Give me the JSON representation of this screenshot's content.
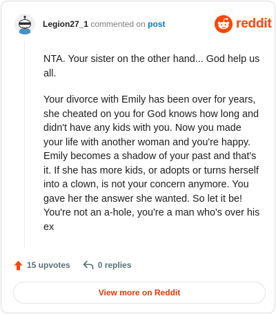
{
  "comment": {
    "username": "Legion27_1",
    "commented_on": "commented on",
    "post_link": "post",
    "paragraphs": [
      "NTA. Your sister on the other hand... God help us all.",
      "Your divorce with Emily has been over for years, she cheated on you for God knows how long and didn't have any kids with you. Now you made your life with another woman and you're happy. Emily becomes a shadow of your past and that's it. If she has more kids, or adopts or turns herself into a clown, is not your concern anymore. You gave her the answer she wanted. So let it be! You're not an a-hole, you're a man who's over his ex"
    ]
  },
  "brand": {
    "logo_text": "reddit",
    "accent": "#ff4500",
    "link": "#0079d3"
  },
  "actions": {
    "upvotes": "15 upvotes",
    "replies": "0 replies",
    "upvote_icon": "upvote-arrow-icon",
    "reply_icon": "reply-arrow-icon"
  },
  "footer": {
    "view_more": "View more on Reddit"
  }
}
